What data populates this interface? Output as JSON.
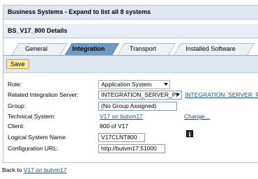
{
  "header": {
    "title": "Business Systems - Expand to list all 8 systems",
    "subtitle": "BS_V17_800 Details"
  },
  "tabs": [
    {
      "label": "General",
      "active": false
    },
    {
      "label": "Integration",
      "active": true
    },
    {
      "label": "Transport",
      "active": false
    },
    {
      "label": "Installed Software",
      "active": false
    }
  ],
  "toolbar": {
    "save_label": "Save"
  },
  "form": {
    "role": {
      "label": "Role:",
      "value": "Application System"
    },
    "related_server": {
      "label": "Related Integration Server:",
      "value": "INTEGRATION_SERVER_PI",
      "link": "INTEGRATION_SERVER_PI"
    },
    "group": {
      "label": "Group:",
      "value": "(No Group Assigned)"
    },
    "technical_system": {
      "label": "Technical System:",
      "value": "V17 on butvm17",
      "action": "Change..."
    },
    "client": {
      "label": "Client:",
      "value": "800 of V17"
    },
    "logical_system_name": {
      "label": "Logical System Name:",
      "value": "V17CLNT800",
      "info_icon": "info-icon"
    },
    "configuration_url": {
      "label": "Configuration URL:",
      "value": "http://butvm17:51000"
    }
  },
  "footer": {
    "back_prefix": "Back to",
    "back_link": "V17 on butvm17"
  },
  "colors": {
    "header_bg": "#dfe8f1",
    "active_tab": "#6f9bc4",
    "save_button": "#fbe89a",
    "link": "#1a4ea8"
  }
}
